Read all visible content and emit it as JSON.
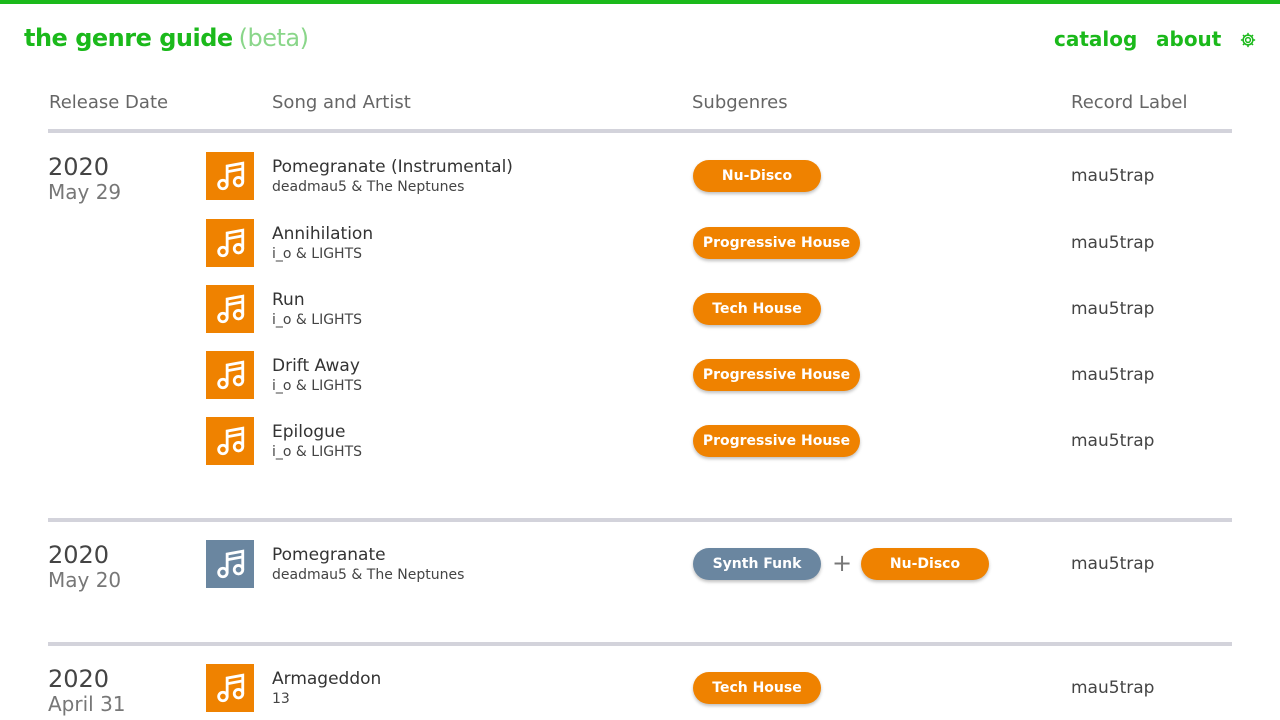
{
  "header": {
    "brand_name": "the genre guide",
    "brand_tag": "(beta)",
    "nav": [
      "catalog",
      "about"
    ],
    "accent_color": "#1bb91b",
    "settings_icon": "gear-icon"
  },
  "columns": [
    "Release Date",
    "Song and Artist",
    "Subgenres",
    "Record Label"
  ],
  "colors": {
    "orange": "#ef8200",
    "slate": "#6a86a0"
  },
  "groups": [
    {
      "year": "2020",
      "day": "May 29",
      "tracks": [
        {
          "title": "Pomegranate (Instrumental)",
          "artist": "deadmau5 & The Neptunes",
          "genres": [
            "Nu-Disco"
          ],
          "label": "mau5trap"
        },
        {
          "title": "Annihilation",
          "artist": "i_o & LIGHTS",
          "genres": [
            "Progressive House"
          ],
          "label": "mau5trap"
        },
        {
          "title": "Run",
          "artist": "i_o & LIGHTS",
          "genres": [
            "Tech House"
          ],
          "label": "mau5trap"
        },
        {
          "title": "Drift Away",
          "artist": "i_o & LIGHTS",
          "genres": [
            "Progressive House"
          ],
          "label": "mau5trap"
        },
        {
          "title": "Epilogue",
          "artist": "i_o & LIGHTS",
          "genres": [
            "Progressive House"
          ],
          "label": "mau5trap"
        }
      ]
    },
    {
      "year": "2020",
      "day": "May 20",
      "tracks": [
        {
          "title": "Pomegranate",
          "artist": "deadmau5 & The Neptunes",
          "genres": [
            "Synth Funk",
            "Nu-Disco"
          ],
          "label": "mau5trap"
        }
      ]
    },
    {
      "year": "2020",
      "day": "April 31",
      "tracks": [
        {
          "title": "Armageddon",
          "artist": "13",
          "genres": [
            "Tech House"
          ],
          "label": "mau5trap"
        }
      ]
    }
  ]
}
